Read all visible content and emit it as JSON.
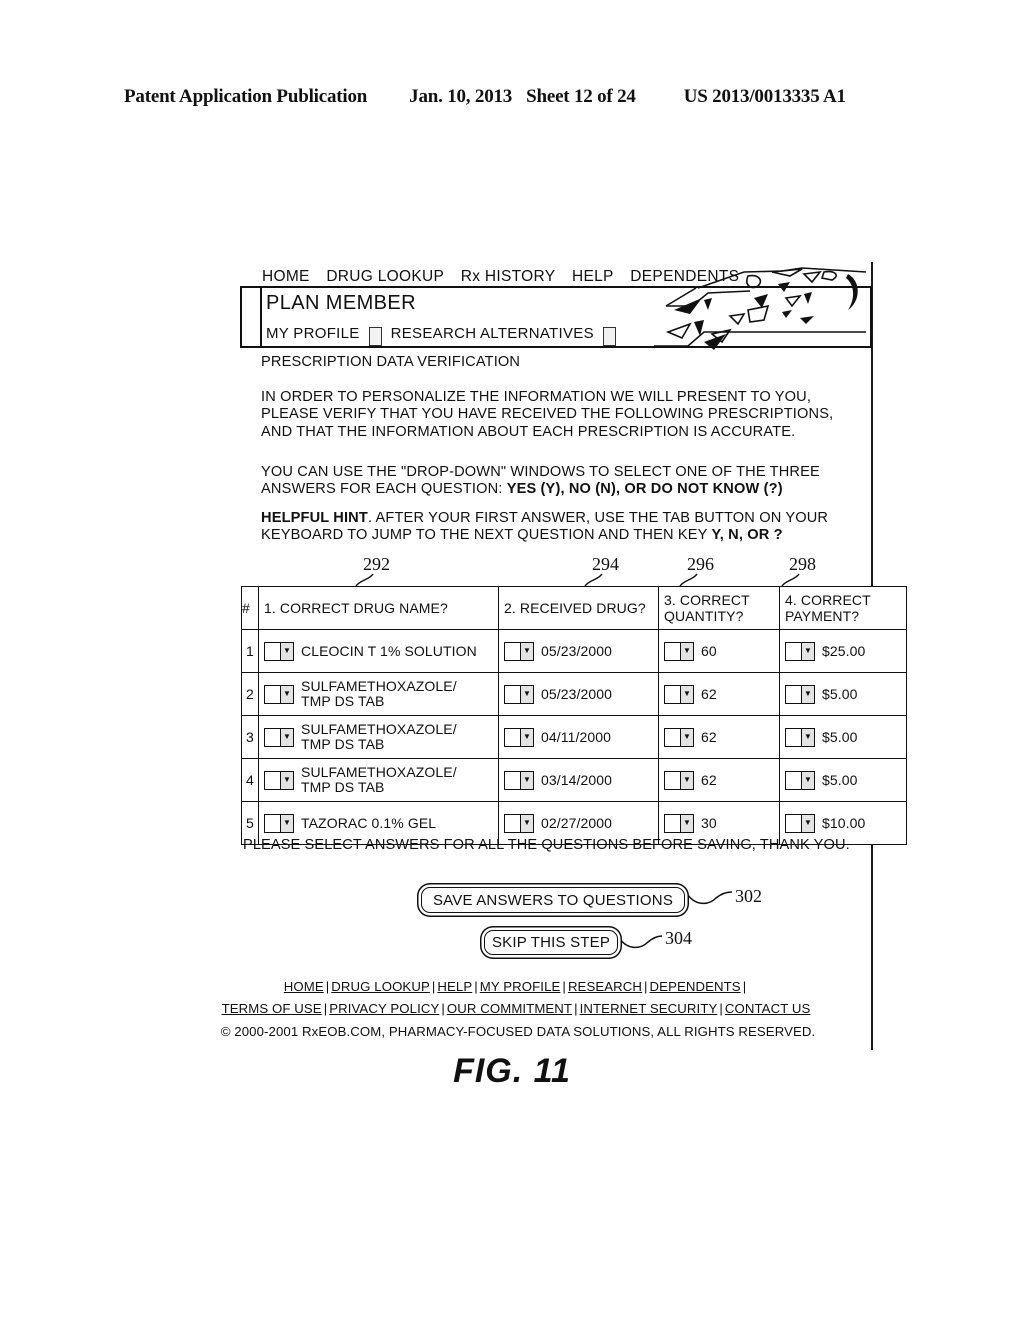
{
  "publication": {
    "title": "Patent Application Publication",
    "date": "Jan. 10, 2013",
    "sheet": "Sheet 12 of 24",
    "number": "US 2013/0013335 A1"
  },
  "figure": {
    "caption": "FIG. 11"
  },
  "topnav": {
    "items": [
      {
        "label": "HOME"
      },
      {
        "label": "DRUG LOOKUP"
      },
      {
        "label": "Rx HISTORY"
      },
      {
        "label": "HELP"
      },
      {
        "label": "DEPENDENTS"
      }
    ]
  },
  "banner": {
    "title": "PLAN MEMBER",
    "tabs": [
      {
        "label": "MY PROFILE"
      },
      {
        "label": "RESEARCH ALTERNATIVES"
      }
    ]
  },
  "page": {
    "section_title": "PRESCRIPTION DATA VERIFICATION",
    "paragraph_1": "IN ORDER TO PERSONALIZE THE INFORMATION WE WILL PRESENT TO YOU,\nPLEASE VERIFY THAT YOU HAVE RECEIVED THE FOLLOWING PRESCRIPTIONS,\nAND THAT THE INFORMATION ABOUT EACH PRESCRIPTION IS ACCURATE.",
    "paragraph_2_plain": "YOU CAN USE THE \"DROP-DOWN\" WINDOWS TO SELECT ONE OF THE THREE\nANSWERS FOR EACH QUESTION: ",
    "paragraph_2_bold": "YES (Y), NO (N), OR DO NOT KNOW (?)",
    "paragraph_3_bold": "HELPFUL HINT",
    "paragraph_3_plain": ". AFTER YOUR FIRST ANSWER, USE THE TAB BUTTON ON YOUR\nKEYBOARD TO JUMP TO THE NEXT QUESTION AND THEN KEY ",
    "paragraph_3_bold_2": "Y, N, OR ?",
    "notice": "PLEASE SELECT ANSWERS FOR ALL THE QUESTIONS BEFORE SAVING, THANK YOU."
  },
  "reference_numerals": [
    {
      "value": "292",
      "target": "column-correct-drug-name"
    },
    {
      "value": "294",
      "target": "column-received-drug"
    },
    {
      "value": "296",
      "target": "column-correct-quantity"
    },
    {
      "value": "298",
      "target": "column-correct-payment"
    },
    {
      "value": "302",
      "target": "save-answers-button"
    },
    {
      "value": "304",
      "target": "skip-this-step-button"
    }
  ],
  "table": {
    "headers": [
      "#",
      "1. CORRECT DRUG NAME?",
      "2. RECEIVED DRUG?",
      "3. CORRECT\nQUANTITY?",
      "4. CORRECT\nPAYMENT?"
    ],
    "dropdown_value": "",
    "dropdown_arrow": "▼",
    "rows": [
      {
        "num": "1",
        "drug_name": "CLEOCIN T 1% SOLUTION",
        "received_date": "05/23/2000",
        "quantity": "60",
        "payment": "$25.00"
      },
      {
        "num": "2",
        "drug_name": "SULFAMETHOXAZOLE/\nTMP DS TAB",
        "received_date": "05/23/2000",
        "quantity": "62",
        "payment": "$5.00"
      },
      {
        "num": "3",
        "drug_name": "SULFAMETHOXAZOLE/\nTMP DS TAB",
        "received_date": "04/11/2000",
        "quantity": "62",
        "payment": "$5.00"
      },
      {
        "num": "4",
        "drug_name": "SULFAMETHOXAZOLE/\nTMP DS TAB",
        "received_date": "03/14/2000",
        "quantity": "62",
        "payment": "$5.00"
      },
      {
        "num": "5",
        "drug_name": "TAZORAC 0.1% GEL",
        "received_date": "02/27/2000",
        "quantity": "30",
        "payment": "$10.00"
      }
    ]
  },
  "buttons": {
    "save": "SAVE ANSWERS TO QUESTIONS",
    "skip": "SKIP THIS STEP"
  },
  "footer": {
    "row1": [
      "HOME",
      "DRUG LOOKUP",
      "HELP",
      "MY PROFILE",
      "RESEARCH",
      "DEPENDENTS"
    ],
    "row2": [
      "TERMS OF USE",
      "PRIVACY POLICY",
      "OUR COMMITMENT",
      "INTERNET SECURITY",
      "CONTACT US"
    ],
    "separator": "|",
    "copyright": "© 2000-2001 RxEOB.COM, PHARMACY-FOCUSED DATA SOLUTIONS, ALL RIGHTS RESERVED."
  }
}
